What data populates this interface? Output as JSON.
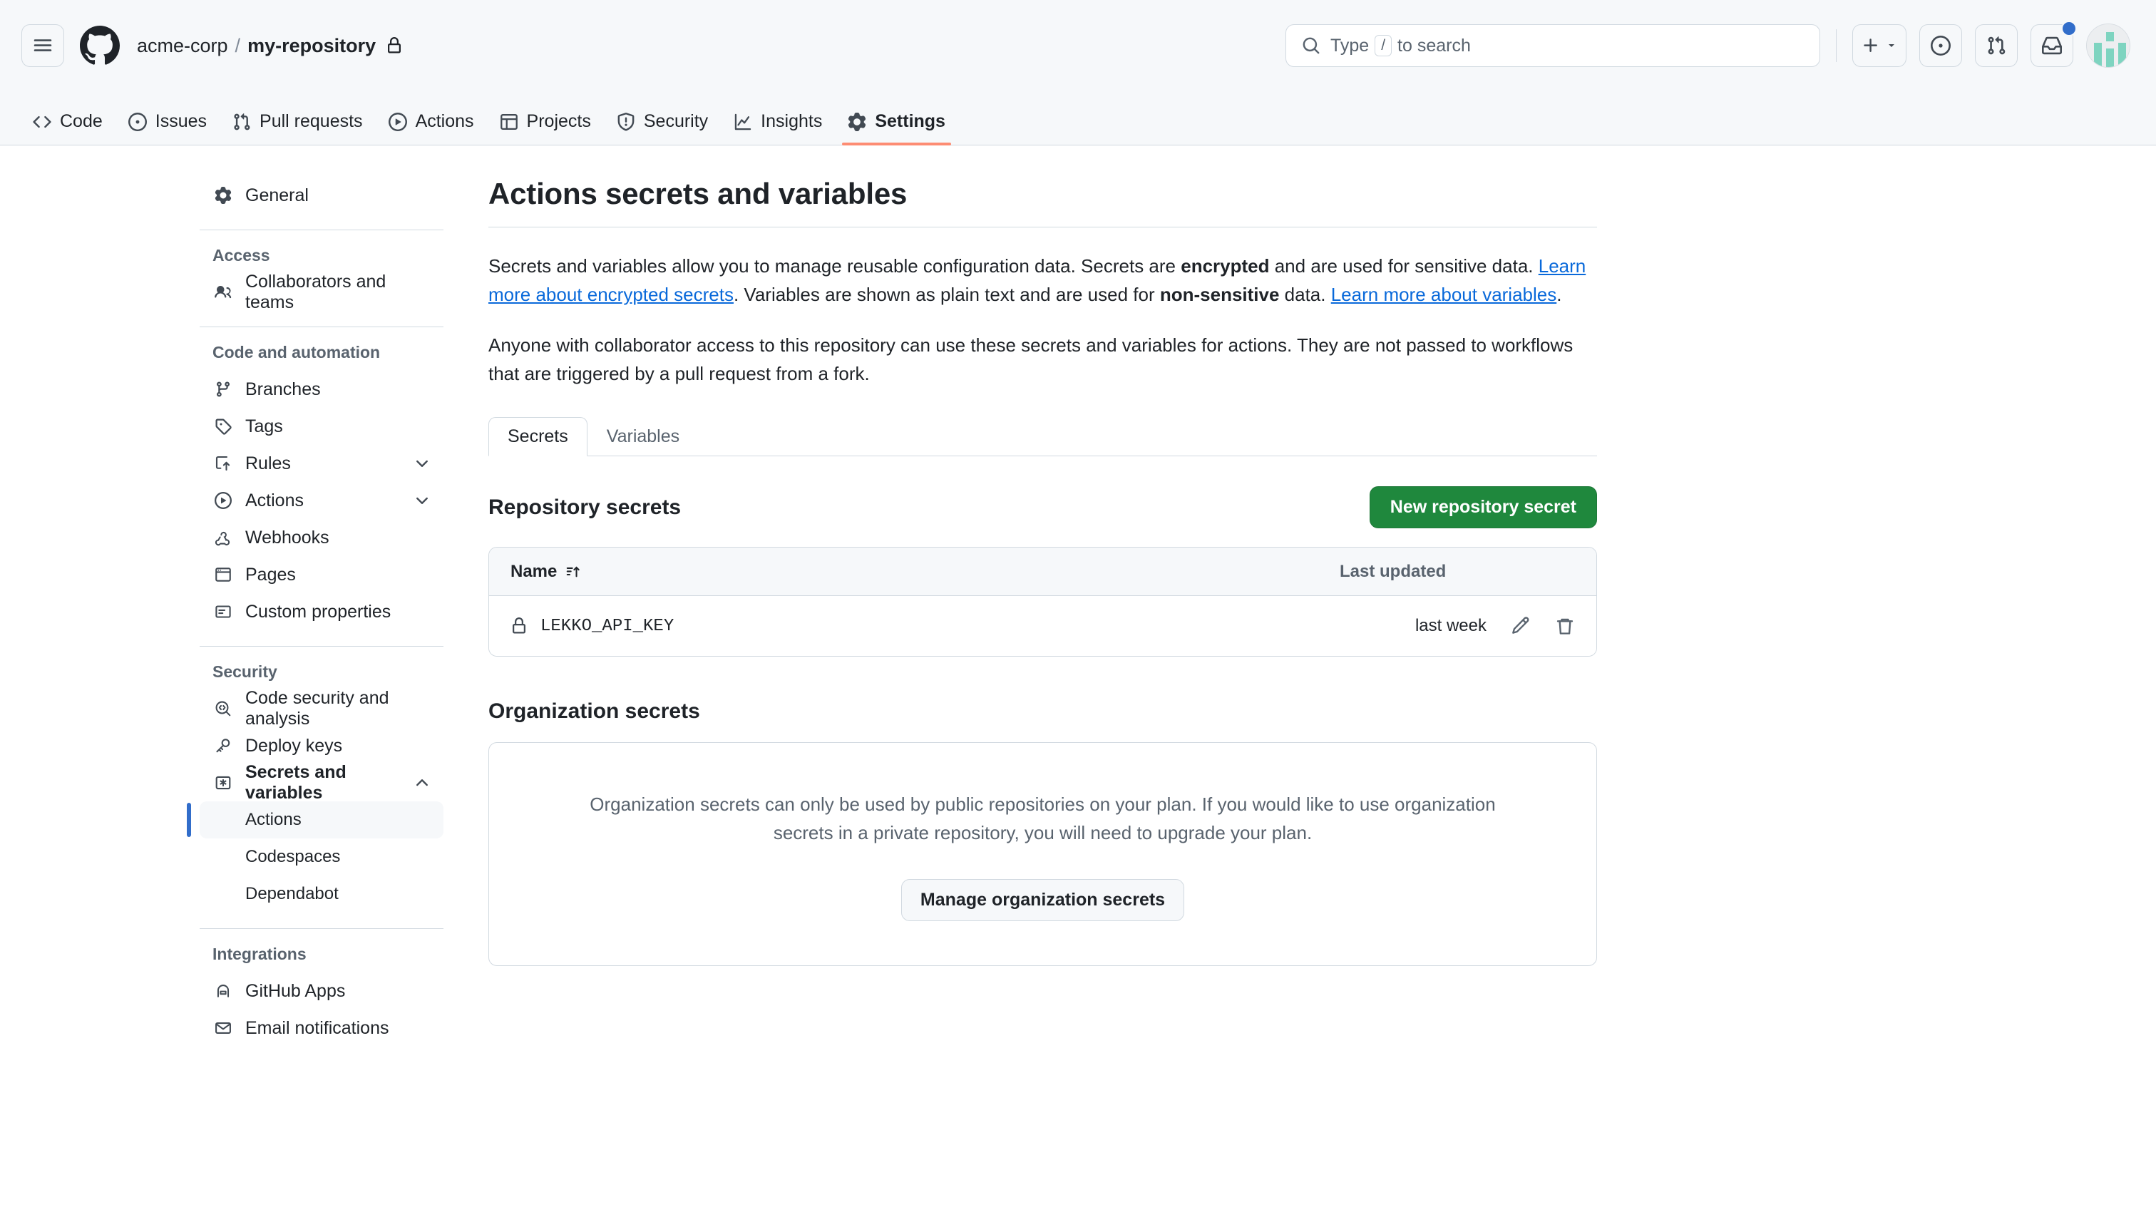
{
  "header": {
    "menu_label": "Open global navigation menu",
    "logo_name": "GitHub",
    "breadcrumb": {
      "owner": "acme-corp",
      "separator": "/",
      "repo": "my-repository",
      "visibility_icon": "lock-icon"
    },
    "search": {
      "placeholder_pre": "Type",
      "placeholder_key": "/",
      "placeholder_post": "to search"
    },
    "actions": {
      "create_new": "+",
      "create_new_caret": "▾",
      "issues_icon": "issue-opened-icon",
      "pull_requests_icon": "git-pull-request-icon",
      "notifications_icon": "inbox-icon",
      "notifications_unread": true,
      "avatar_name": "user-avatar"
    }
  },
  "repo_nav": {
    "tabs": [
      {
        "label": "Code",
        "icon": "code-icon",
        "active": false
      },
      {
        "label": "Issues",
        "icon": "issue-opened-icon",
        "active": false
      },
      {
        "label": "Pull requests",
        "icon": "git-pull-request-icon",
        "active": false
      },
      {
        "label": "Actions",
        "icon": "play-icon",
        "active": false
      },
      {
        "label": "Projects",
        "icon": "table-icon",
        "active": false
      },
      {
        "label": "Security",
        "icon": "shield-icon",
        "active": false
      },
      {
        "label": "Insights",
        "icon": "graph-icon",
        "active": false
      },
      {
        "label": "Settings",
        "icon": "gear-icon",
        "active": true
      }
    ]
  },
  "sidebar": {
    "top_item": {
      "label": "General",
      "icon": "gear-icon"
    },
    "groups": [
      {
        "title": "Access",
        "items": [
          {
            "label": "Collaborators and teams",
            "icon": "people-icon"
          }
        ]
      },
      {
        "title": "Code and automation",
        "items": [
          {
            "label": "Branches",
            "icon": "git-branch-icon"
          },
          {
            "label": "Tags",
            "icon": "tag-icon"
          },
          {
            "label": "Rules",
            "icon": "rules-icon",
            "expandable": true,
            "expanded": false
          },
          {
            "label": "Actions",
            "icon": "play-icon",
            "expandable": true,
            "expanded": false
          },
          {
            "label": "Webhooks",
            "icon": "webhook-icon"
          },
          {
            "label": "Pages",
            "icon": "browser-icon"
          },
          {
            "label": "Custom properties",
            "icon": "note-icon"
          }
        ]
      },
      {
        "title": "Security",
        "items": [
          {
            "label": "Code security and analysis",
            "icon": "codescan-icon"
          },
          {
            "label": "Deploy keys",
            "icon": "key-icon"
          },
          {
            "label": "Secrets and variables",
            "icon": "asterisk-icon",
            "expandable": true,
            "expanded": true,
            "bold": true
          }
        ],
        "subitems": [
          {
            "label": "Actions",
            "selected": true
          },
          {
            "label": "Codespaces",
            "selected": false
          },
          {
            "label": "Dependabot",
            "selected": false
          }
        ]
      },
      {
        "title": "Integrations",
        "items": [
          {
            "label": "GitHub Apps",
            "icon": "apps-icon"
          },
          {
            "label": "Email notifications",
            "icon": "mail-icon"
          }
        ]
      }
    ]
  },
  "main": {
    "title": "Actions secrets and variables",
    "intro": {
      "p1_a": "Secrets and variables allow you to manage reusable configuration data. Secrets are ",
      "p1_bold1": "encrypted",
      "p1_b": " and are used for sensitive data. ",
      "p1_link1": "Learn more about encrypted secrets",
      "p1_c": ". Variables are shown as plain text and are used for ",
      "p1_bold2": "non-sensitive",
      "p1_d": " data. ",
      "p1_link2": "Learn more about variables",
      "p1_e": ".",
      "p2": "Anyone with collaborator access to this repository can use these secrets and variables for actions. They are not passed to workflows that are triggered by a pull request from a fork."
    },
    "tabs": [
      {
        "label": "Secrets",
        "active": true
      },
      {
        "label": "Variables",
        "active": false
      }
    ],
    "repository_secrets": {
      "title": "Repository secrets",
      "new_button": "New repository secret",
      "columns": {
        "name": "Name",
        "sort_icon": "sort-asc-icon",
        "last_updated": "Last updated"
      },
      "rows": [
        {
          "icon": "lock-icon",
          "name": "LEKKO_API_KEY",
          "last_updated": "last week",
          "edit_icon": "pencil-icon",
          "delete_icon": "trash-icon"
        }
      ]
    },
    "organization_secrets": {
      "title": "Organization secrets",
      "empty_message": "Organization secrets can only be used by public repositories on your plan. If you would like to use organization secrets in a private repository, you will need to upgrade your plan.",
      "button": "Manage organization secrets"
    }
  },
  "colors": {
    "accent_green": "#1f883d",
    "link_blue": "#0969da",
    "active_tab_underline": "#fd8c73",
    "selected_bar": "#316dca",
    "canvas_subtle": "#f6f8fa",
    "border": "#d1d9e0"
  }
}
